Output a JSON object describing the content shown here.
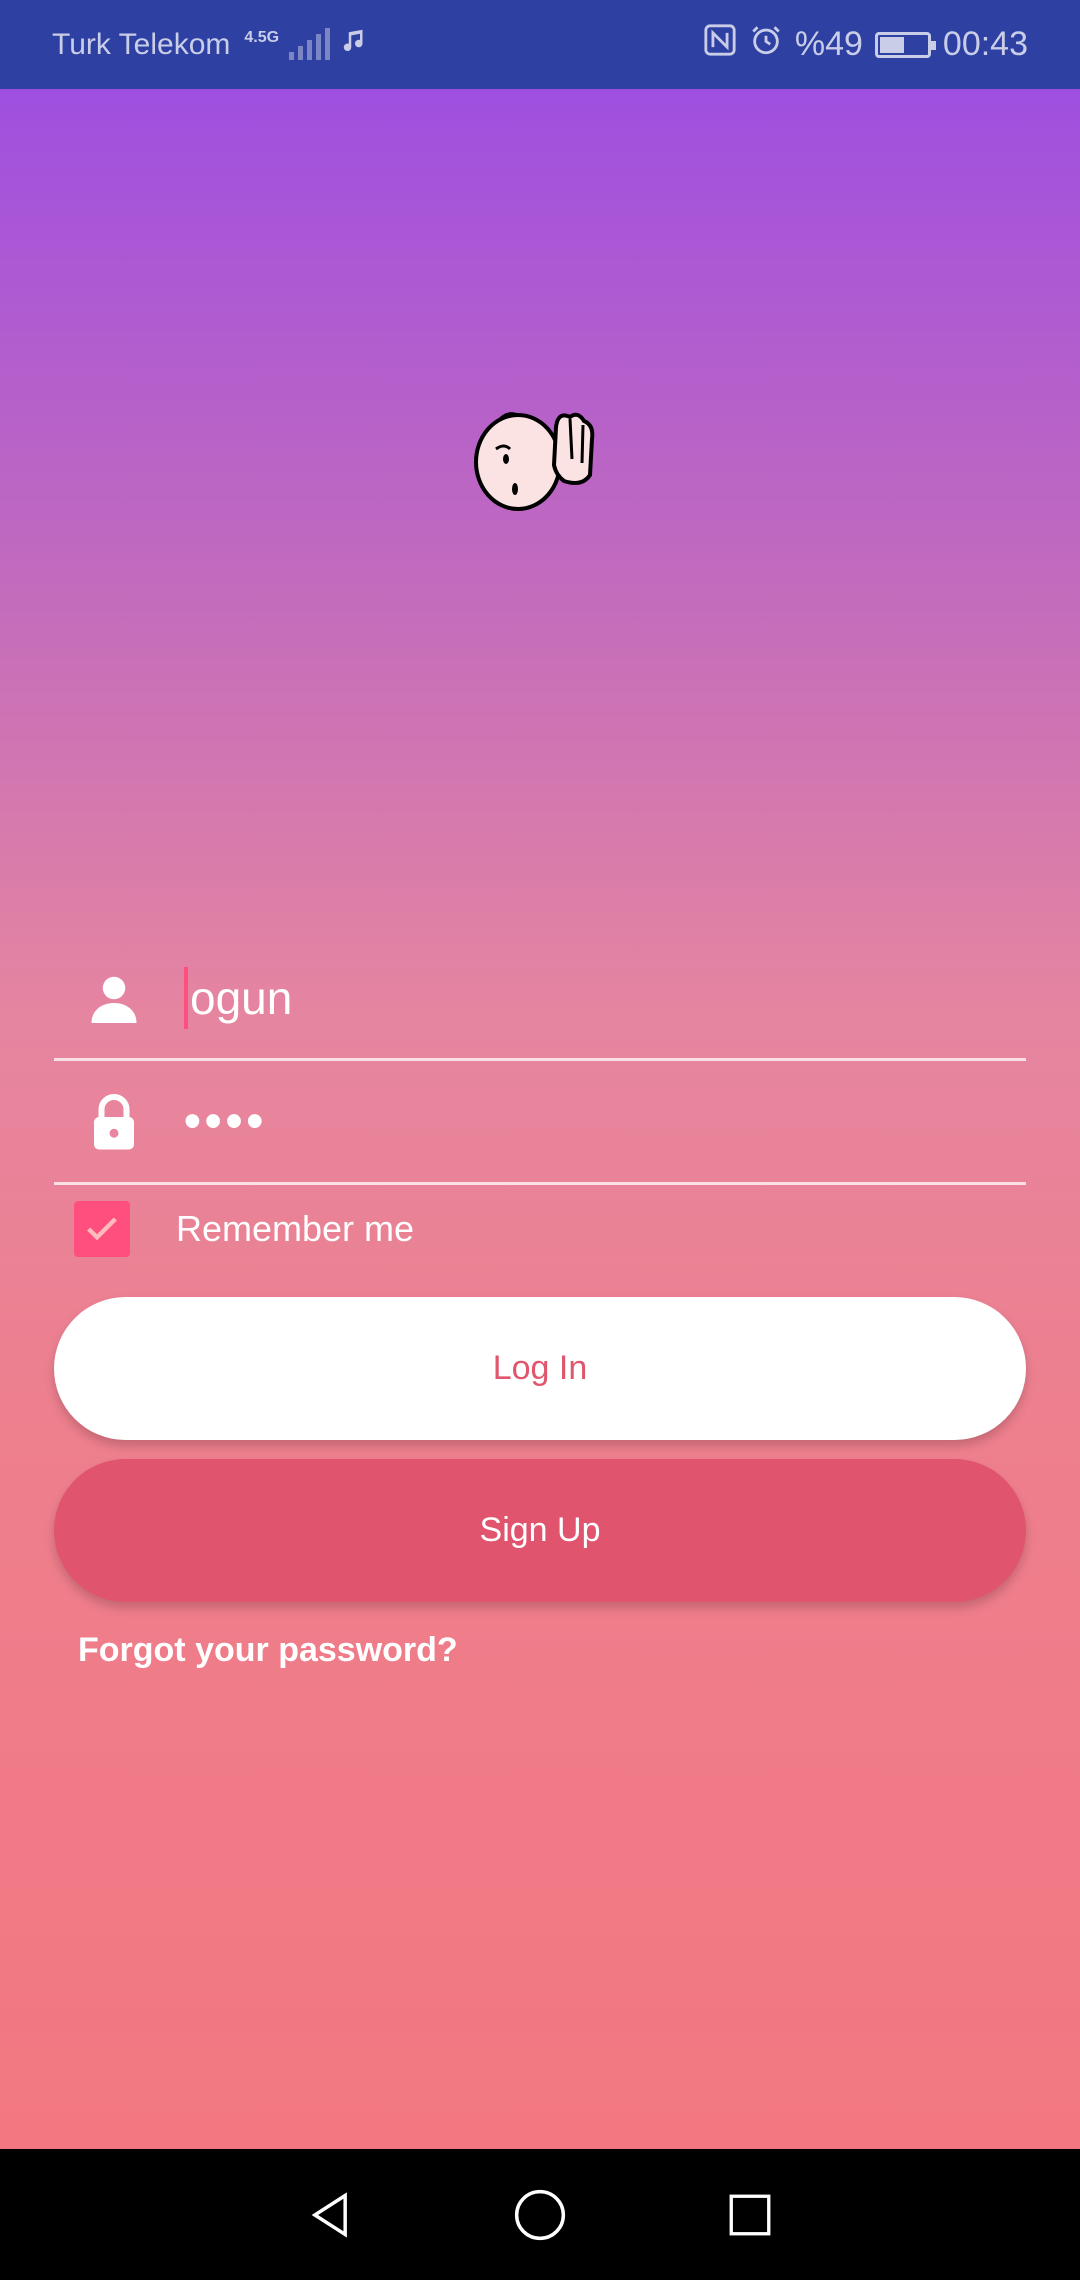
{
  "status_bar": {
    "carrier": "Turk Telekom",
    "network_type": "4.5G",
    "battery_percent": "%49",
    "time": "00:43",
    "icons": [
      "music-note-icon",
      "nfc-icon",
      "alarm-icon",
      "battery-icon"
    ]
  },
  "login": {
    "username_value": "ogun",
    "password_value": "••••",
    "remember_label": "Remember me",
    "remember_checked": true,
    "login_label": "Log In",
    "signup_label": "Sign Up",
    "forgot_label": "Forgot your password?"
  },
  "colors": {
    "gradient_top": "#9f4fe0",
    "gradient_bottom": "#f27781",
    "accent": "#ff4f7f",
    "signup_button": "#e0546e",
    "status_bar": "#2e40a2"
  },
  "nav_bar": {
    "icons": [
      "back-icon",
      "home-icon",
      "recents-icon"
    ]
  }
}
